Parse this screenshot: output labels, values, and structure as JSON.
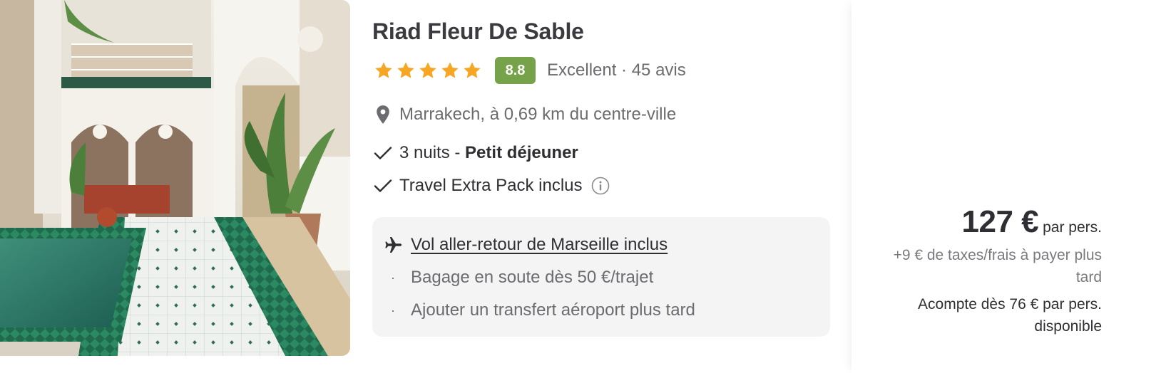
{
  "hotel": {
    "name": "Riad Fleur De Sable",
    "stars": 5,
    "score": "8.8",
    "review_summary": "Excellent · 45 avis",
    "location": "Marrakech, à 0,69 km du centre-ville",
    "features": {
      "nights_prefix": "3 nuits - ",
      "board": "Petit déjeuner",
      "extra_pack": "Travel Extra Pack inclus"
    }
  },
  "flight": {
    "title": "Vol aller-retour de Marseille inclus",
    "bullet_glyph": "·",
    "items": [
      "Bagage en soute dès 50 €/trajet",
      "Ajouter un transfert aéroport plus tard"
    ]
  },
  "pricing": {
    "price": "127 €",
    "per_person": "par pers.",
    "taxes_note": "+9 € de taxes/frais à payer plus tard",
    "deposit_note": "Acompte dès 76 € par pers. disponible"
  },
  "colors": {
    "star": "#f6a623",
    "score_bg": "#76a34a",
    "flight_box_bg": "#f4f4f5"
  },
  "icons": {
    "location": "map-pin-icon",
    "check": "check-icon",
    "info": "info-icon",
    "flight": "airplane-icon",
    "rating": "star-icon"
  }
}
